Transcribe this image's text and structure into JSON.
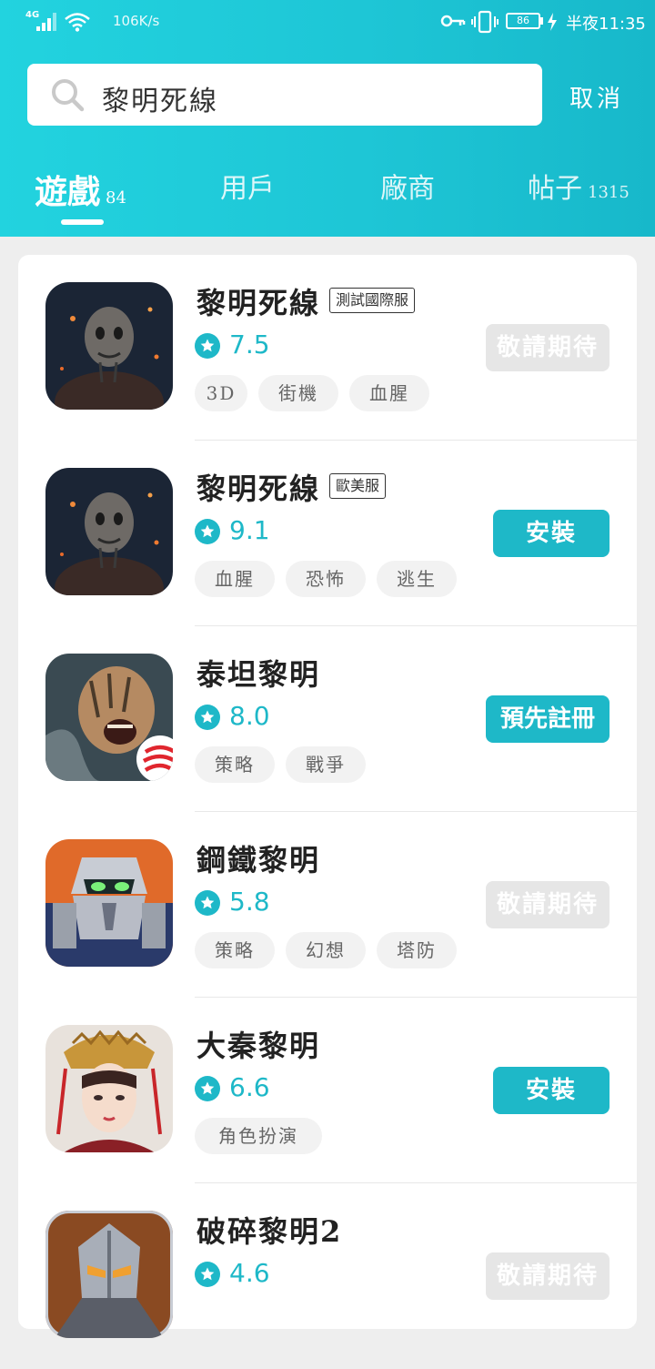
{
  "status_bar": {
    "network": "4G",
    "speed": "106K/s",
    "battery": "86",
    "time": "半夜11:35"
  },
  "search": {
    "query": "黎明死線",
    "cancel_label": "取消"
  },
  "tabs": [
    {
      "label": "遊戲",
      "count": "84",
      "active": true
    },
    {
      "label": "用戶",
      "count": "",
      "active": false
    },
    {
      "label": "廠商",
      "count": "",
      "active": false
    },
    {
      "label": "帖子",
      "count": "1315",
      "active": false
    }
  ],
  "colors": {
    "accent": "#1eb8c8",
    "header_start": "#22d3df",
    "header_end": "#17b8ca",
    "disabled_button": "#e6e6e6"
  },
  "games": [
    {
      "name": "黎明死線",
      "badge": "測試國際服",
      "score": "7.5",
      "tags": [
        "3D",
        "街機",
        "血腥"
      ],
      "action": "敬請期待",
      "action_type": "soon",
      "icon": "dead-by-daylight-icon"
    },
    {
      "name": "黎明死線",
      "badge": "歐美服",
      "score": "9.1",
      "tags": [
        "血腥",
        "恐怖",
        "逃生"
      ],
      "action": "安裝",
      "action_type": "install",
      "icon": "dead-by-daylight-icon"
    },
    {
      "name": "泰坦黎明",
      "badge": "",
      "score": "8.0",
      "tags": [
        "策略",
        "戰爭"
      ],
      "action": "預先註冊",
      "action_type": "pre",
      "icon": "titan-dawn-icon"
    },
    {
      "name": "鋼鐵黎明",
      "badge": "",
      "score": "5.8",
      "tags": [
        "策略",
        "幻想",
        "塔防"
      ],
      "action": "敬請期待",
      "action_type": "soon",
      "icon": "robot-icon"
    },
    {
      "name": "大秦黎明",
      "badge": "",
      "score": "6.6",
      "tags": [
        "角色扮演"
      ],
      "action": "安裝",
      "action_type": "install",
      "icon": "empress-icon"
    },
    {
      "name": "破碎黎明2",
      "badge": "",
      "score": "4.6",
      "tags": [],
      "action": "敬請期待",
      "action_type": "soon",
      "icon": "armored-knight-icon"
    }
  ]
}
